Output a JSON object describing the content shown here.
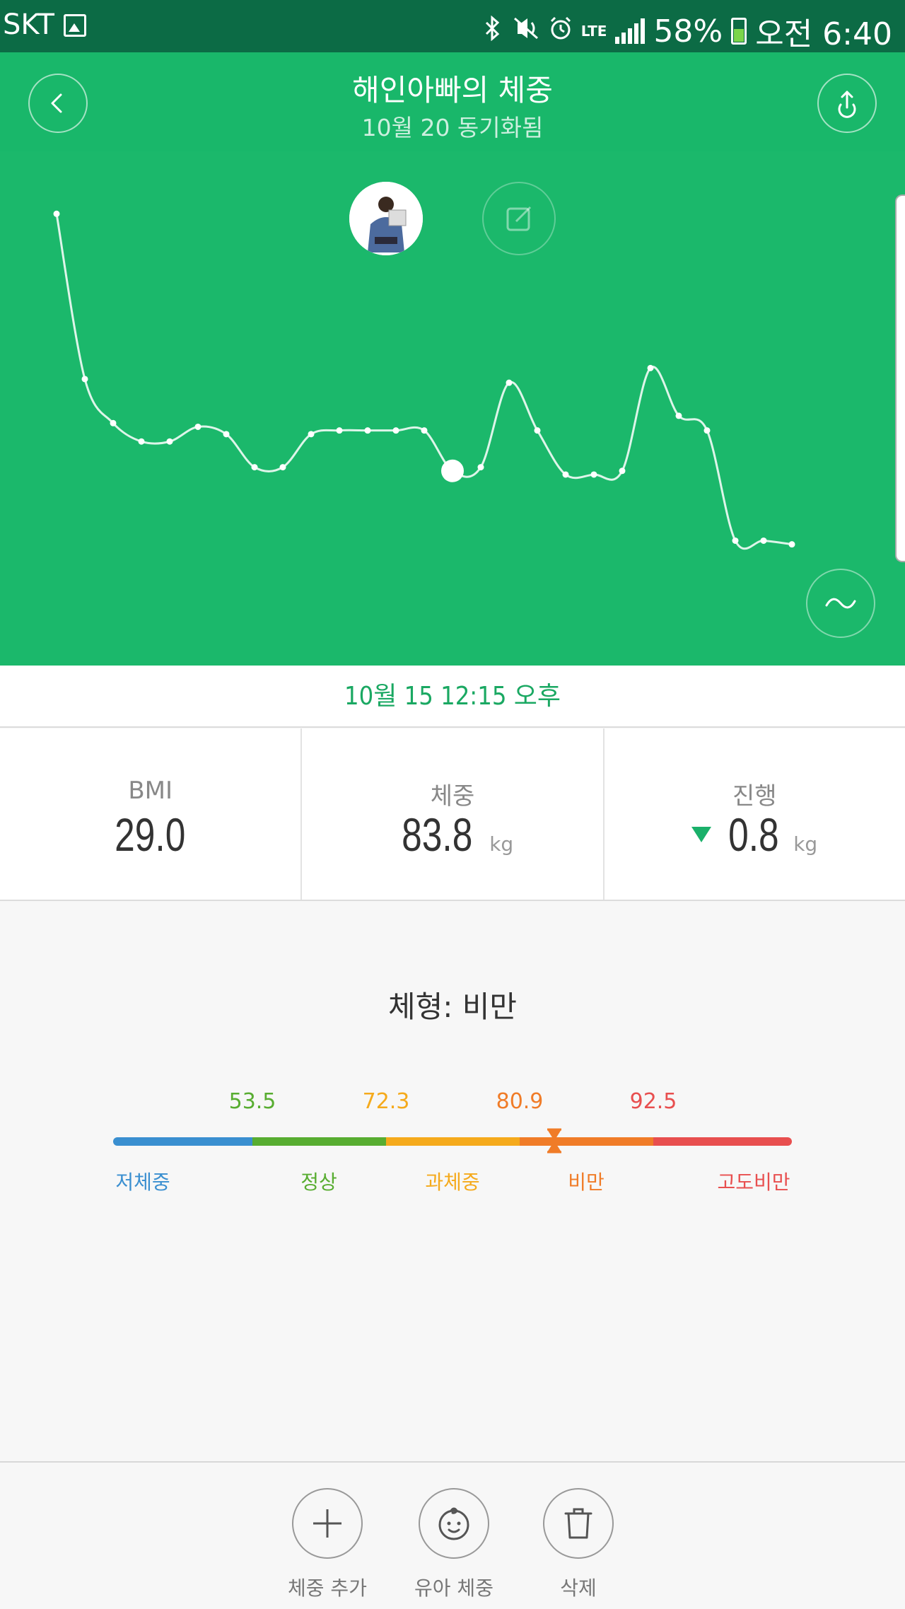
{
  "status_bar": {
    "carrier": "SKT",
    "network": "LTE",
    "battery": "58%",
    "time": "오전 6:40",
    "icons": [
      "gallery-icon",
      "bluetooth-icon",
      "vibrate-icon",
      "alarm-icon",
      "signal-icon",
      "battery-icon"
    ]
  },
  "header": {
    "title": "해인아빠의 체중",
    "subtitle": "10월 20 동기화됨",
    "back_icon": "chevron-left-icon",
    "upload_icon": "upload-icon"
  },
  "chart_data": {
    "type": "line",
    "title": "",
    "xlabel": "",
    "ylabel": "",
    "selected_index": 14,
    "x": [
      1,
      2,
      3,
      4,
      5,
      6,
      7,
      8,
      9,
      10,
      11,
      12,
      13,
      14,
      15,
      16,
      17,
      18,
      19,
      20,
      21,
      22,
      23,
      24,
      25,
      26,
      27
    ],
    "values": [
      90.8,
      86.3,
      85.1,
      84.6,
      84.6,
      85.0,
      84.8,
      83.9,
      83.9,
      84.8,
      84.9,
      84.9,
      84.9,
      84.9,
      83.8,
      83.9,
      86.2,
      84.9,
      83.7,
      83.7,
      83.8,
      86.6,
      85.3,
      84.9,
      81.9,
      81.9,
      81.8
    ],
    "ylim": [
      78.5,
      92.5
    ],
    "colors": {
      "line": "#ffffff",
      "background": "#1bb86b"
    }
  },
  "selected_date": "10월 15 12:15 오후",
  "stats": [
    {
      "label": "BMI",
      "value": "29.0",
      "unit": ""
    },
    {
      "label": "체중",
      "value": "83.8",
      "unit": "kg"
    },
    {
      "label": "진행",
      "value": "0.8",
      "unit": "kg",
      "trend": "down"
    }
  ],
  "body_type": {
    "label": "체형: 비만",
    "thresholds": [
      "53.5",
      "72.3",
      "80.9",
      "92.5"
    ],
    "categories": [
      "저체중",
      "정상",
      "과체중",
      "비만",
      "고도비만"
    ],
    "colors": [
      "#3a8fd0",
      "#58ad31",
      "#f5aa1c",
      "#f07c28",
      "#e84f4f"
    ],
    "current_value": 83.8
  },
  "toolbar": {
    "add_weight": "체중 추가",
    "baby_weight": "유아 체중",
    "delete": "삭제"
  }
}
